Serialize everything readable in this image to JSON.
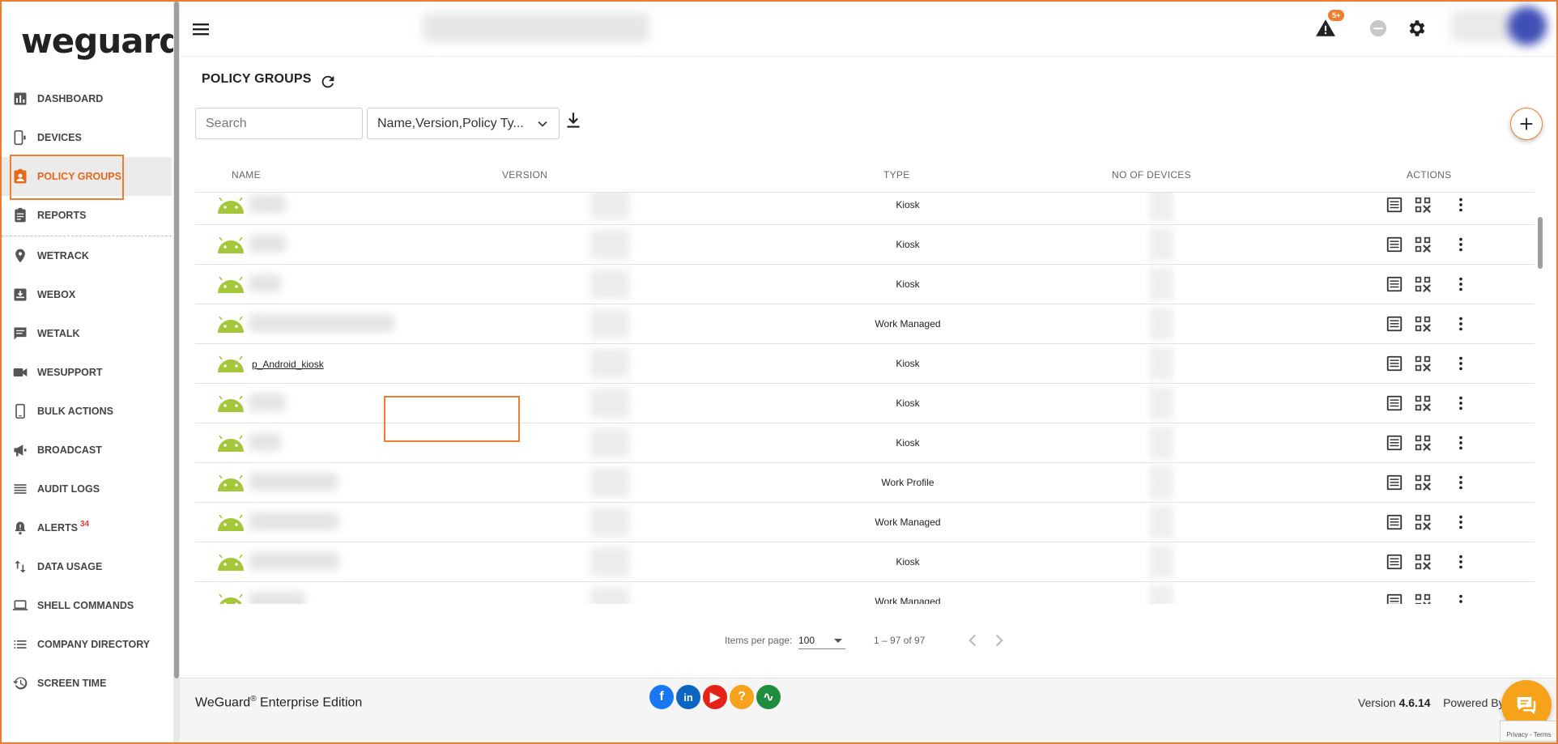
{
  "app": {
    "logo_text": "weguard"
  },
  "sidebar": {
    "items": [
      {
        "label": "DASHBOARD",
        "icon": "bar-chart-icon"
      },
      {
        "label": "DEVICES",
        "icon": "devices-icon"
      },
      {
        "label": "POLICY GROUPS",
        "icon": "policy-badge-icon",
        "active": true
      },
      {
        "label": "REPORTS",
        "icon": "clipboard-icon"
      },
      {
        "label": "WETRACK",
        "icon": "location-pin-icon"
      },
      {
        "label": "WEBOX",
        "icon": "inbox-download-icon"
      },
      {
        "label": "WETALK",
        "icon": "chat-icon"
      },
      {
        "label": "WESUPPORT",
        "icon": "videocam-icon"
      },
      {
        "label": "BULK ACTIONS",
        "icon": "phone-icon"
      },
      {
        "label": "BROADCAST",
        "icon": "megaphone-icon"
      },
      {
        "label": "AUDIT LOGS",
        "icon": "list-lines-icon"
      },
      {
        "label": "ALERTS",
        "icon": "bell-alert-icon",
        "count": "34"
      },
      {
        "label": "DATA USAGE",
        "icon": "up-down-arrows-icon"
      },
      {
        "label": "SHELL COMMANDS",
        "icon": "laptop-icon"
      },
      {
        "label": "COMPANY DIRECTORY",
        "icon": "list-bullets-icon"
      },
      {
        "label": "SCREEN TIME",
        "icon": "history-icon"
      }
    ]
  },
  "topbar": {
    "alert_badge": "5+",
    "icons": [
      "hamburger-menu-icon",
      "warning-icon",
      "minus-circle-icon",
      "gear-icon"
    ]
  },
  "page": {
    "title": "POLICY GROUPS",
    "search_placeholder": "Search",
    "filter_value": "Name,Version,Policy Ty..."
  },
  "table": {
    "columns": [
      "NAME",
      "VERSION",
      "TYPE",
      "NO OF DEVICES",
      "ACTIONS"
    ],
    "rows": [
      {
        "name": "",
        "type": "Kiosk"
      },
      {
        "name": "",
        "type": "Kiosk"
      },
      {
        "name": "",
        "type": "Kiosk"
      },
      {
        "name": "",
        "type": "Work Managed"
      },
      {
        "name": "p_Android_kiosk",
        "type": "Kiosk"
      },
      {
        "name": "",
        "type": "Kiosk"
      },
      {
        "name": "",
        "type": "Kiosk"
      },
      {
        "name": "",
        "type": "Work Profile"
      },
      {
        "name": "",
        "type": "Work Managed"
      },
      {
        "name": "",
        "type": "Kiosk"
      },
      {
        "name": "",
        "type": "Work Managed"
      }
    ]
  },
  "paginator": {
    "items_per_page_label": "Items per page:",
    "page_size": "100",
    "range": "1 – 97 of 97"
  },
  "footer": {
    "brand": "WeGuard",
    "registered": "®",
    "edition": " Enterprise Edition",
    "version_label": "Version",
    "version": "4.6.14",
    "powered_by": "Powered By",
    "social": [
      {
        "icon": "facebook-icon",
        "color": "#1877f2",
        "glyph": "f"
      },
      {
        "icon": "linkedin-icon",
        "color": "#0a66c2",
        "glyph": "in"
      },
      {
        "icon": "youtube-icon",
        "color": "#e62117",
        "glyph": "▶"
      },
      {
        "icon": "help-icon",
        "color": "#f7a21b",
        "glyph": "?"
      },
      {
        "icon": "pulse-icon",
        "color": "#1e8e3e",
        "glyph": "∿"
      }
    ],
    "recaptcha_text": "Privacy - Terms"
  },
  "colors": {
    "accent": "#f07c2f",
    "android_green": "#a4c639"
  }
}
